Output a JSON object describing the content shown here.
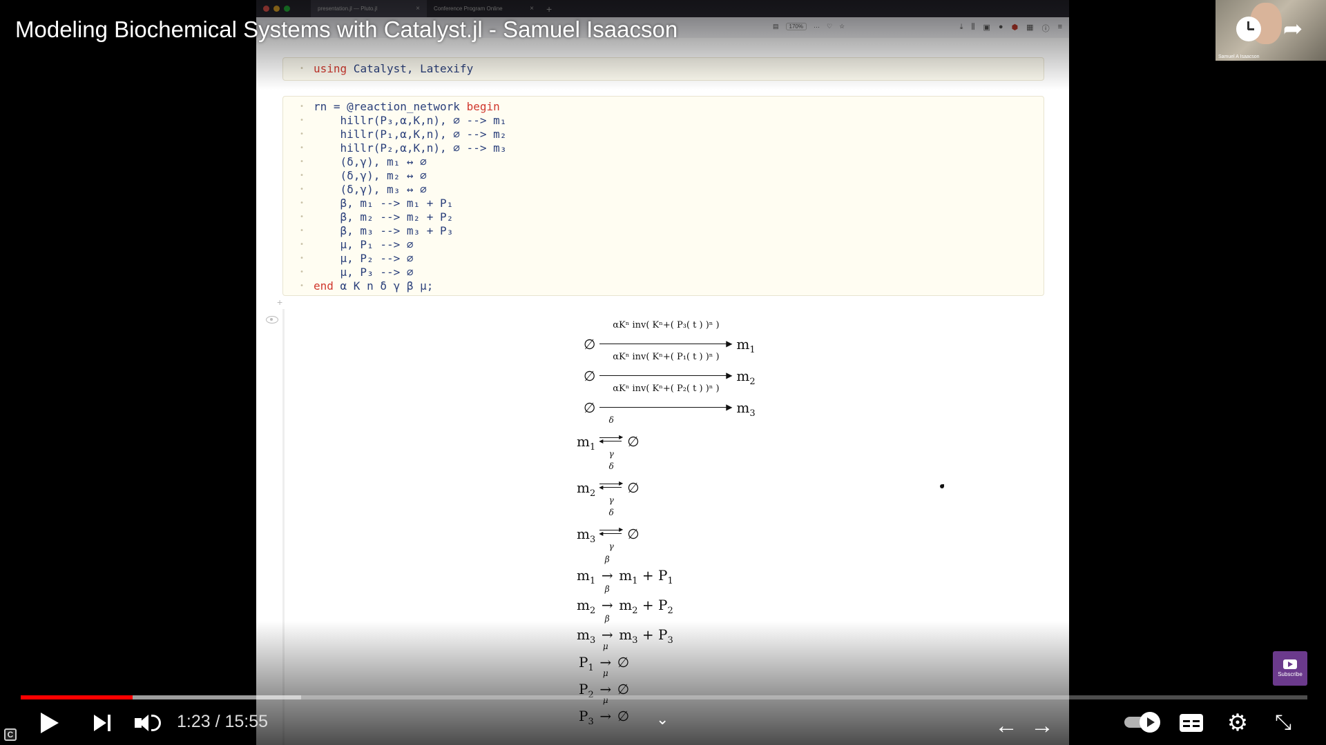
{
  "video": {
    "title": "Modeling Biochemical Systems with Catalyst.jl - Samuel Isaacson",
    "current_time": "1:23",
    "duration": "15:55",
    "time_text": "1:23 / 15:55",
    "progress_fraction": 0.087,
    "buffered_fraction": 0.218,
    "presenter_label": "Samuel A Isaacson",
    "subscribe_label": "Subscribe",
    "c_badge": "C"
  },
  "colors": {
    "progress_played": "#ff0000",
    "notebook_cell_bg": "#fffdf2",
    "keyword": "#d0372d",
    "code_text": "#2a3f7a"
  },
  "browser": {
    "tabs": [
      {
        "label": "presentation.jl — Pluto.jl",
        "active": true
      },
      {
        "label": "Conference Program Online",
        "active": false
      }
    ],
    "zoom": "170%"
  },
  "notebook": {
    "cell_using": {
      "keyword": "using",
      "rest": " Catalyst, Latexify"
    },
    "cell_rn": {
      "first_line_prefix": "rn = @reaction_network ",
      "first_line_keyword": "begin",
      "lines": [
        "    hillr(P₃,α,K,n), ∅ --> m₁",
        "    hillr(P₁,α,K,n), ∅ --> m₂",
        "    hillr(P₂,α,K,n), ∅ --> m₃",
        "    (δ,γ), m₁ ↔ ∅",
        "    (δ,γ), m₂ ↔ ∅",
        "    (δ,γ), m₃ ↔ ∅",
        "    β, m₁ --> m₁ + P₁",
        "    β, m₂ --> m₂ + P₂",
        "    β, m₃ --> m₃ + P₃",
        "    μ, P₁ --> ∅",
        "    μ, P₂ --> ∅",
        "    μ, P₃ --> ∅"
      ],
      "last_line_keyword": "end",
      "last_line_rest": " α K n δ γ β μ;"
    }
  },
  "latex": {
    "hill_reactions": [
      {
        "rate": "αKⁿ inv( Kⁿ+( P₃( t ) )ⁿ )",
        "lhs": "∅",
        "rhs": "m",
        "rhs_sub": "1"
      },
      {
        "rate": "αKⁿ inv( Kⁿ+( P₁( t ) )ⁿ )",
        "lhs": "∅",
        "rhs": "m",
        "rhs_sub": "2"
      },
      {
        "rate": "αKⁿ inv( Kⁿ+( P₂( t ) )ⁿ )",
        "lhs": "∅",
        "rhs": "m",
        "rhs_sub": "3"
      }
    ],
    "reversible_reactions": [
      {
        "lhs": "m",
        "lhs_sub": "1",
        "top": "δ",
        "bottom": "γ",
        "rhs": "∅"
      },
      {
        "lhs": "m",
        "lhs_sub": "2",
        "top": "δ",
        "bottom": "γ",
        "rhs": "∅"
      },
      {
        "lhs": "m",
        "lhs_sub": "3",
        "top": "δ",
        "bottom": "γ",
        "rhs": "∅"
      }
    ],
    "production_reactions": [
      {
        "lhs": "m",
        "sub": "1",
        "label": "β",
        "rhs_m": "m",
        "rhs_p": "P"
      },
      {
        "lhs": "m",
        "sub": "2",
        "label": "β",
        "rhs_m": "m",
        "rhs_p": "P"
      },
      {
        "lhs": "m",
        "sub": "3",
        "label": "β",
        "rhs_m": "m",
        "rhs_p": "P"
      }
    ],
    "decay_reactions": [
      {
        "lhs": "P",
        "sub": "1",
        "label": "μ",
        "rhs": "∅"
      },
      {
        "lhs": "P",
        "sub": "2",
        "label": "μ",
        "rhs": "∅"
      },
      {
        "lhs": "P",
        "sub": "3",
        "label": "μ",
        "rhs": "∅"
      }
    ]
  },
  "icons": {
    "watch_later": "clock-icon",
    "share": "share-arrow-icon",
    "play": "play-icon",
    "next": "next-icon",
    "volume": "volume-icon",
    "chapter": "chevron-down-icon",
    "back": "arrow-left-icon",
    "forward": "arrow-right-icon",
    "autoplay": "autoplay-toggle-icon",
    "captions": "captions-icon",
    "settings": "gear-icon",
    "exit_fullscreen": "exit-fullscreen-icon",
    "subscribe": "subscribe-icon"
  }
}
